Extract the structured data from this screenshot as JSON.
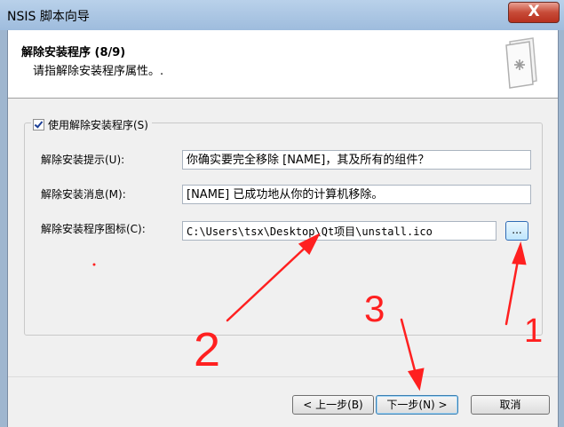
{
  "window": {
    "title": "NSIS 脚本向导",
    "close_glyph": "X"
  },
  "header": {
    "title": "解除安装程序 (8/9)",
    "subtitle": "请指解除安装程序属性。."
  },
  "options": {
    "checkbox_label": "使用解除安装程序(S)",
    "checked": true,
    "prompt_label": "解除安装提示(U):",
    "prompt_value": "你确实要完全移除 [NAME]，其及所有的组件？",
    "message_label": "解除安装消息(M):",
    "message_value": "[NAME] 已成功地从你的计算机移除。",
    "icon_label": "解除安装程序图标(C):",
    "icon_value": "C:\\Users\\tsx\\Desktop\\Qt项目\\unstall.ico",
    "browse_label": "..."
  },
  "buttons": {
    "back": "< 上一步(B)",
    "next": "下一步(N) >",
    "cancel": "取消"
  },
  "annotations": {
    "mark_1": "1",
    "mark_2": "2",
    "mark_3": "3",
    "color": "#ff2020"
  }
}
